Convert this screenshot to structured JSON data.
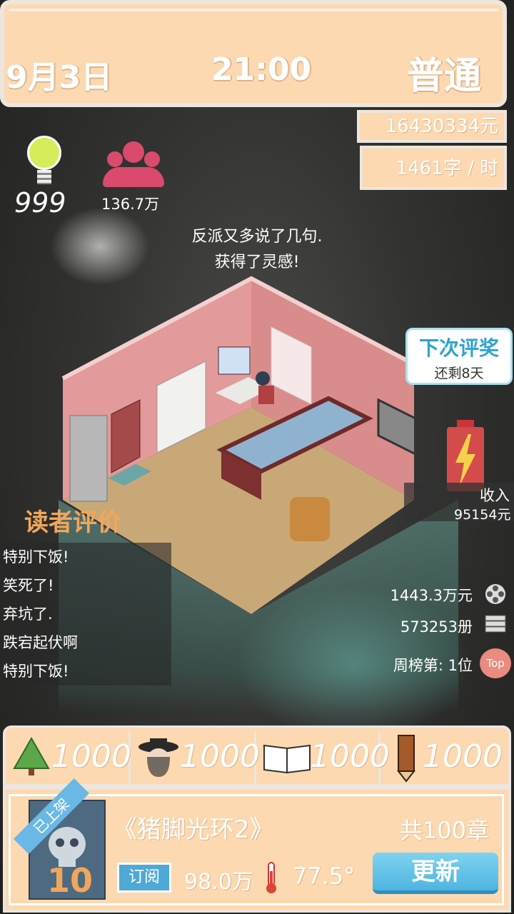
{
  "header": {
    "date": "9月3日",
    "time": "21:00",
    "difficulty": "普通",
    "money": "16430334元",
    "speed": "1461字 / 时"
  },
  "stats": {
    "inspiration": "999",
    "fans": "136.7万"
  },
  "message": {
    "line1": "反派又多说了几句.",
    "line2": "获得了灵感!"
  },
  "award": {
    "title": "下次评奖",
    "remaining": "还剩8天"
  },
  "income": {
    "label": "收入",
    "value": "95154元"
  },
  "reviews": {
    "title": "读者评价",
    "items": [
      "特别下饭!",
      "笑死了!",
      "弃坑了.",
      "跌宕起伏啊",
      "特别下饭!"
    ]
  },
  "ranking": {
    "revenue": "1443.3万元",
    "copies": "573253册",
    "weekly": "周榜第: 1位",
    "top_label": "Top"
  },
  "resources": [
    {
      "icon": "tree-icon",
      "value": "1000"
    },
    {
      "icon": "character-icon",
      "value": "1000"
    },
    {
      "icon": "book-icon",
      "value": "1000"
    },
    {
      "icon": "pencil-icon",
      "value": "1000"
    }
  ],
  "book": {
    "status_ribbon": "已上架",
    "cover_number": "10",
    "title": "《猪脚光环2》",
    "chapters": "共100章",
    "subscribe_label": "订阅",
    "subscribers": "98.0万",
    "heat": "77.5°",
    "update_button": "更新"
  },
  "colors": {
    "panel": "#fcd9b0",
    "accent_blue": "#4fa9d6",
    "review_title": "#f2a65a",
    "fans_icon": "#d94a6c"
  }
}
